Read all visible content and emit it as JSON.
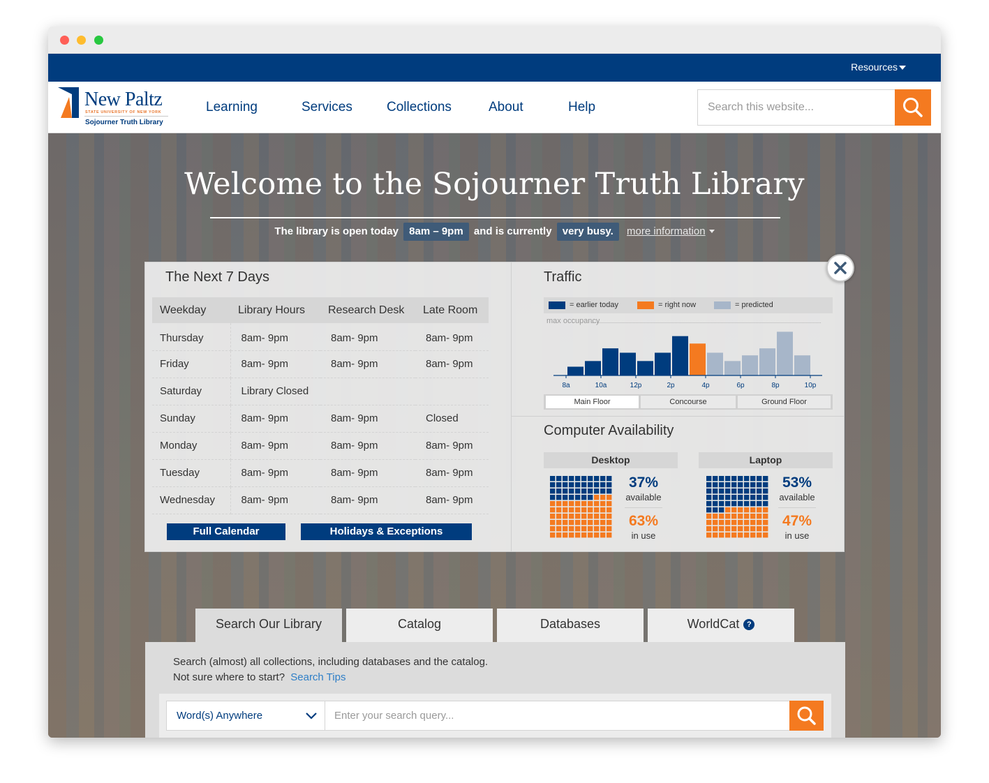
{
  "colors": {
    "navy": "#003c7e",
    "orange": "#f47a20",
    "predicted": "#a7b6c9"
  },
  "utility": {
    "resources_label": "Resources"
  },
  "logo": {
    "name": "New Paltz",
    "suny": "STATE UNIVERSITY OF NEW YORK",
    "subtitle": "Sojourner Truth Library"
  },
  "nav": {
    "items": [
      "Learning",
      "Services",
      "Collections",
      "About",
      "Help"
    ]
  },
  "site_search": {
    "placeholder": "Search this website..."
  },
  "hero": {
    "title": "Welcome to the Sojourner Truth Library",
    "status_prefix": "The library is open today",
    "hours": "8am – 9pm",
    "status_mid": "and is currently",
    "busy": "very busy.",
    "more_info": "more information"
  },
  "hours_panel": {
    "title": "The Next 7 Days",
    "columns": [
      "Weekday",
      "Library Hours",
      "Research Desk",
      "Late Room"
    ],
    "rows": [
      [
        "Thursday",
        "8am- 9pm",
        "8am- 9pm",
        "8am- 9pm"
      ],
      [
        "Friday",
        "8am- 9pm",
        "8am- 9pm",
        "8am- 9pm"
      ],
      [
        "Saturday",
        "Library Closed",
        "",
        ""
      ],
      [
        "Sunday",
        "8am- 9pm",
        "8am- 9pm",
        "Closed"
      ],
      [
        "Monday",
        "8am- 9pm",
        "8am- 9pm",
        "8am- 9pm"
      ],
      [
        "Tuesday",
        "8am- 9pm",
        "8am- 9pm",
        "8am- 9pm"
      ],
      [
        "Wednesday",
        "8am- 9pm",
        "8am- 9pm",
        "8am- 9pm"
      ]
    ],
    "full_calendar": "Full Calendar",
    "holidays": "Holidays & Exceptions"
  },
  "traffic": {
    "title": "Traffic",
    "legend": [
      {
        "label": "= earlier today",
        "color": "#003c7e"
      },
      {
        "label": "= right now",
        "color": "#f47a20"
      },
      {
        "label": "= predicted",
        "color": "#a7b6c9"
      }
    ],
    "max_label": "max occupancy",
    "tabs": [
      "Main Floor",
      "Concourse",
      "Ground Floor"
    ],
    "active_tab": "Main Floor"
  },
  "chart_data": {
    "type": "bar",
    "categories": [
      "8a",
      "9a",
      "10a",
      "11a",
      "12p",
      "1p",
      "2p",
      "3p",
      "4p",
      "5p",
      "6p",
      "7p",
      "8p",
      "9p",
      "10p"
    ],
    "x_tick_labels": [
      "8a",
      "10a",
      "12p",
      "2p",
      "4p",
      "6p",
      "8p",
      "10p"
    ],
    "values": [
      0.2,
      0.33,
      0.62,
      0.52,
      0.33,
      0.52,
      0.9,
      0.73,
      0.52,
      0.33,
      0.46,
      0.62,
      1.0,
      0.46
    ],
    "status": [
      "earlier",
      "earlier",
      "earlier",
      "earlier",
      "earlier",
      "earlier",
      "earlier",
      "now",
      "predicted",
      "predicted",
      "predicted",
      "predicted",
      "predicted",
      "predicted"
    ],
    "ylim": [
      0,
      1.15
    ],
    "annotations": [
      "max occupancy"
    ],
    "legend": [
      "= earlier today",
      "= right now",
      "= predicted"
    ]
  },
  "computers": {
    "title": "Computer Availability",
    "groups": [
      {
        "name": "Desktop",
        "available_pct": "37%",
        "available_label": "available",
        "inuse_pct": "63%",
        "inuse_label": "in use",
        "available_fraction": 0.37
      },
      {
        "name": "Laptop",
        "available_pct": "53%",
        "available_label": "available",
        "inuse_pct": "47%",
        "inuse_label": "in use",
        "available_fraction": 0.53
      }
    ]
  },
  "search": {
    "tabs": [
      "Search Our Library",
      "Catalog",
      "Databases",
      "WorldCat"
    ],
    "active_tab": "Search Our Library",
    "worldcat_help": "?",
    "description": "Search (almost) all collections, including databases and the catalog.",
    "not_sure": "Not sure where to start?",
    "tips_link": "Search Tips",
    "scope_selected": "Word(s) Anywhere",
    "query_placeholder": "Enter your search query..."
  }
}
